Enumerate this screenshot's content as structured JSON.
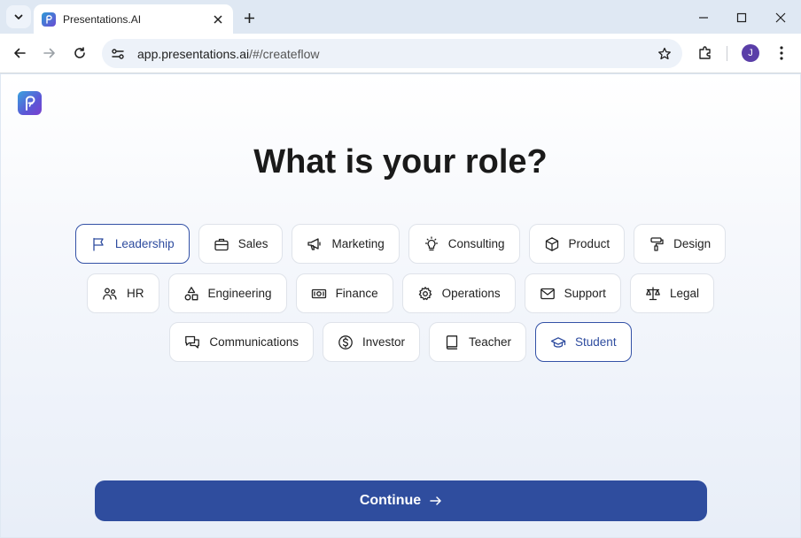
{
  "browser": {
    "tab_title": "Presentations.AI",
    "url_host": "app.presentations.ai",
    "url_path": "/#/createflow",
    "profile_initial": "J"
  },
  "page": {
    "heading": "What is your role?",
    "continue_label": "Continue",
    "accent_color": "#2f4d9e"
  },
  "roles": [
    [
      {
        "label": "Leadership",
        "icon": "flag-icon",
        "selected": true
      },
      {
        "label": "Sales",
        "icon": "briefcase-icon",
        "selected": false
      },
      {
        "label": "Marketing",
        "icon": "megaphone-icon",
        "selected": false
      },
      {
        "label": "Consulting",
        "icon": "lightbulb-icon",
        "selected": false
      },
      {
        "label": "Product",
        "icon": "box-icon",
        "selected": false
      },
      {
        "label": "Design",
        "icon": "paint-roller-icon",
        "selected": false
      }
    ],
    [
      {
        "label": "HR",
        "icon": "people-icon",
        "selected": false
      },
      {
        "label": "Engineering",
        "icon": "shapes-icon",
        "selected": false
      },
      {
        "label": "Finance",
        "icon": "banknote-icon",
        "selected": false
      },
      {
        "label": "Operations",
        "icon": "gear-icon",
        "selected": false
      },
      {
        "label": "Support",
        "icon": "envelope-icon",
        "selected": false
      },
      {
        "label": "Legal",
        "icon": "scales-icon",
        "selected": false
      }
    ],
    [
      {
        "label": "Communications",
        "icon": "chat-bubbles-icon",
        "selected": false
      },
      {
        "label": "Investor",
        "icon": "dollar-coin-icon",
        "selected": false
      },
      {
        "label": "Teacher",
        "icon": "book-icon",
        "selected": false
      },
      {
        "label": "Student",
        "icon": "graduation-cap-icon",
        "selected": true
      }
    ]
  ]
}
